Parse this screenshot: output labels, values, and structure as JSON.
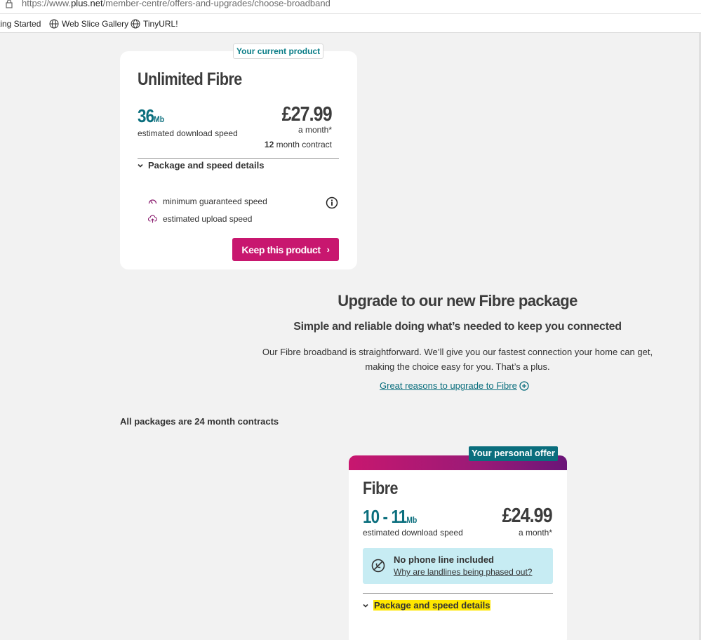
{
  "browser": {
    "url_prefix": "https://www.",
    "url_domain": "plus.net",
    "url_path": "/member-centre/offers-and-upgrades/choose-broadband",
    "bookmarks": [
      {
        "label": "ting Started"
      },
      {
        "label": "Web Slice Gallery",
        "icon": "globe-icon"
      },
      {
        "label": "TinyURL!",
        "icon": "globe-icon"
      }
    ]
  },
  "current_product": {
    "tag": "Your current product",
    "name": "Unlimited Fibre",
    "speed_value": "36",
    "speed_unit": "Mb",
    "speed_label": "estimated download speed",
    "price": "£27.99",
    "price_period": "a month*",
    "contract_length": "12",
    "contract_suffix": " month contract",
    "details_toggle": "Package and speed details",
    "features": [
      {
        "label": "minimum guaranteed speed",
        "icon": "speedometer-icon"
      },
      {
        "label": "estimated upload speed",
        "icon": "cloud-upload-icon"
      }
    ],
    "cta": "Keep this product",
    "cta_arrow": "›"
  },
  "upgrade": {
    "title": "Upgrade to our new Fibre package",
    "subtitle": "Simple and reliable doing what’s needed to keep you connected",
    "body_line1": "Our Fibre broadband is straightforward. We’ll give you our fastest connection your home can get,",
    "body_line2": "making the choice easy for you. That’s a plus.",
    "link": "Great reasons to upgrade to Fibre"
  },
  "contracts_note": "All packages are 24 month contracts",
  "offer": {
    "tag": "Your personal offer",
    "name": "Fibre",
    "speed_value": "10 - 11",
    "speed_unit": "Mb",
    "speed_label": "estimated download speed",
    "price": "£24.99",
    "price_period": "a month*",
    "notice_title": "No phone line included",
    "notice_link": "Why are landlines being phased out?",
    "details_toggle": "Package and speed details"
  },
  "colors": {
    "brand_pink": "#c8176f",
    "teal": "#0a6e7d",
    "notice_bg": "#c7ecf3",
    "highlight": "#ffe700"
  }
}
